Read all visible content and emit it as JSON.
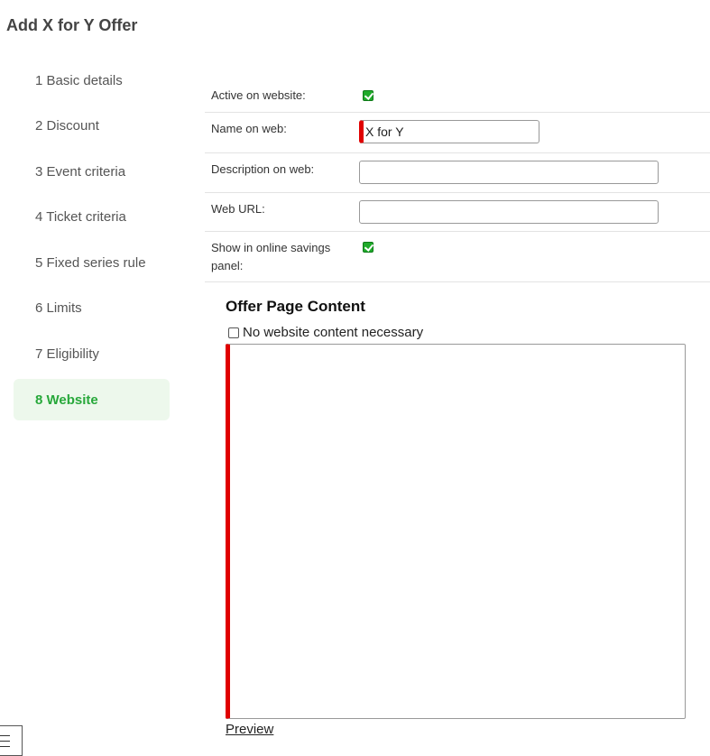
{
  "page": {
    "title": "Add X for Y Offer"
  },
  "steps": [
    {
      "label": "1 Basic details"
    },
    {
      "label": "2 Discount"
    },
    {
      "label": "3 Event criteria"
    },
    {
      "label": "4 Ticket criteria"
    },
    {
      "label": "5 Fixed series rule"
    },
    {
      "label": "6 Limits"
    },
    {
      "label": "7 Eligibility"
    },
    {
      "label": "8 Website",
      "active": true
    }
  ],
  "form": {
    "active_on_website": {
      "label": "Active on website:",
      "checked": true
    },
    "name_on_web": {
      "label": "Name on web:",
      "value": "X for Y"
    },
    "description_on_web": {
      "label": "Description on web:",
      "value": ""
    },
    "web_url": {
      "label": "Web URL:",
      "value": ""
    },
    "show_in_savings_panel": {
      "label": "Show in online savings panel:",
      "checked": true
    }
  },
  "offer_content": {
    "heading": "Offer Page Content",
    "no_content_label": "No website content necessary",
    "no_content_checked": false,
    "preview_label": "Preview"
  },
  "colors": {
    "accent_green": "#27a83a",
    "active_step_bg": "#edf8ec",
    "required_red": "#e00000"
  }
}
